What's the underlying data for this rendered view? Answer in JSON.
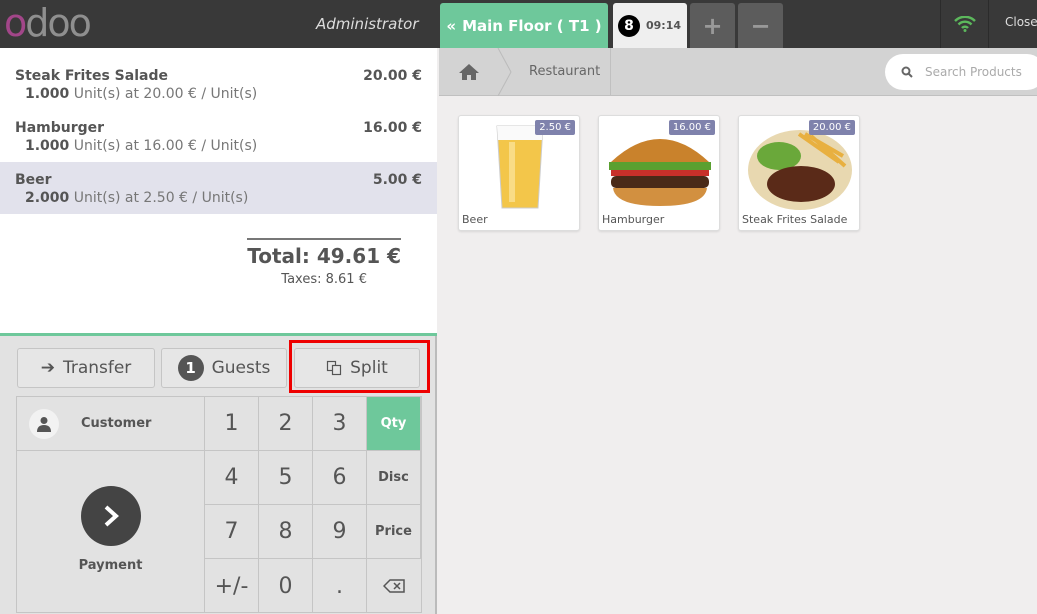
{
  "header": {
    "logo": "odoo",
    "user": "Administrator",
    "floor_button": "Main Floor ( T1 )",
    "order_tab": {
      "number": "8",
      "time": "09:14"
    },
    "add_order": "+",
    "remove_order": "−",
    "close": "Close",
    "wifi_color": "#5cb85c"
  },
  "order": {
    "lines": [
      {
        "name": "Steak Frites Salade",
        "price": "20.00 €",
        "qty": "1.000",
        "info": "Unit(s) at 20.00 € / Unit(s)",
        "selected": false
      },
      {
        "name": "Hamburger",
        "price": "16.00 €",
        "qty": "1.000",
        "info": "Unit(s) at 16.00 € / Unit(s)",
        "selected": false
      },
      {
        "name": "Beer",
        "price": "5.00 €",
        "qty": "2.000",
        "info": "Unit(s) at 2.50 € / Unit(s)",
        "selected": true
      }
    ],
    "total": "Total: 49.61 €",
    "taxes": "Taxes: 8.61 €"
  },
  "actions": {
    "transfer": "Transfer",
    "guests_count": "1",
    "guests": "Guests",
    "split": "Split"
  },
  "numpad": {
    "customer": "Customer",
    "payment": "Payment",
    "keys": [
      "1",
      "2",
      "3",
      "4",
      "5",
      "6",
      "7",
      "8",
      "9",
      "+/-",
      "0",
      "."
    ],
    "modes": [
      "Qty",
      "Disc",
      "Price"
    ],
    "active_mode": "Qty"
  },
  "breadcrumb": {
    "category": "Restaurant"
  },
  "search": {
    "placeholder": "Search Products"
  },
  "products": [
    {
      "name": "Beer",
      "price": "2.50 €"
    },
    {
      "name": "Hamburger",
      "price": "16.00 €"
    },
    {
      "name": "Steak Frites Salade",
      "price": "20.00 €"
    }
  ],
  "colors": {
    "accent": "#6ec89b",
    "highlight": "#e00000",
    "price_tag": "#7f82ac"
  }
}
